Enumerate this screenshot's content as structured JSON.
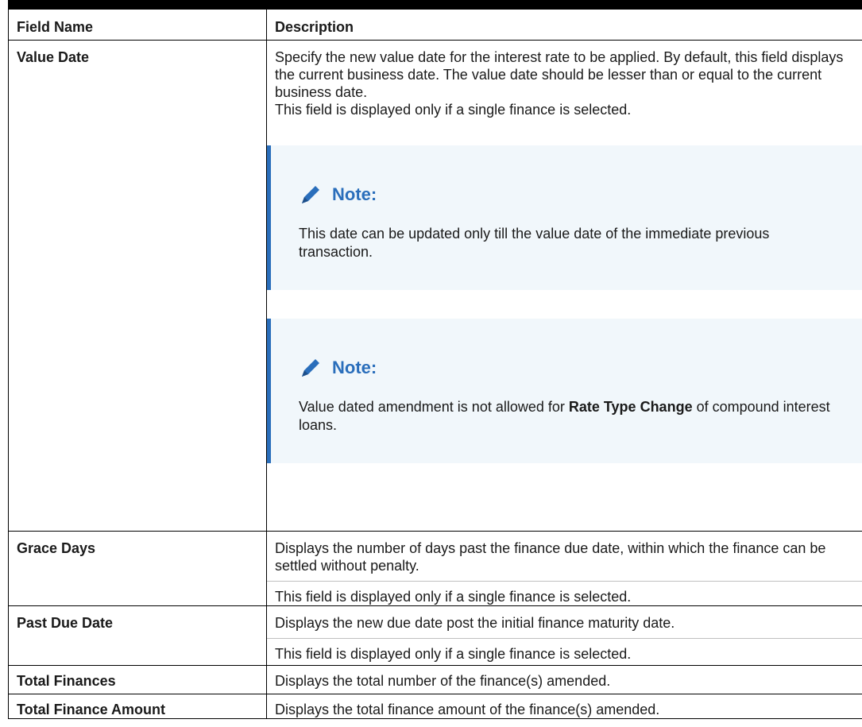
{
  "table": {
    "headers": {
      "field_name": "Field Name",
      "description": "Description"
    },
    "rows": {
      "value_date": {
        "name": "Value Date",
        "desc_1": "Specify the new value date for the interest rate to be applied. By default, this field displays the current business date. The value date should be lesser than or equal to the current business date.",
        "desc_2": "This field is displayed only if a single finance is selected.",
        "note1": {
          "title": "Note:",
          "text": "This date can be updated only till the value date of the immediate previous transaction."
        },
        "note2": {
          "title": "Note:",
          "text_pre": "Value dated amendment is not allowed for ",
          "text_bold": "Rate Type Change",
          "text_post": " of compound interest loans."
        }
      },
      "grace_days": {
        "name": "Grace Days",
        "desc_1": "Displays the number of days past the finance due date, within which the finance can be settled without penalty.",
        "desc_2": "This field is displayed only if a single finance is selected."
      },
      "past_due_date": {
        "name": "Past Due Date",
        "desc_1": "Displays the new due date post the initial finance maturity date.",
        "desc_2": "This field is displayed only if a single finance is selected."
      },
      "total_finances": {
        "name": "Total Finances",
        "desc_1": "Displays the total number of the finance(s) amended."
      },
      "total_finance_amount": {
        "name": "Total Finance Amount",
        "desc_1": "Displays the total finance amount of the finance(s) amended."
      }
    }
  },
  "icons": {
    "note": "pencil-icon"
  },
  "colors": {
    "note_accent": "#2a6ebb",
    "note_background": "#f1f7fb"
  }
}
